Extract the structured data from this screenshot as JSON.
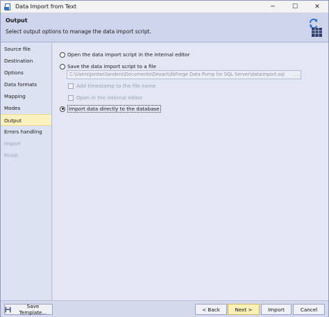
{
  "window": {
    "title": "Data Import from Text",
    "minimize": "─",
    "maximize": "☐",
    "close": "✕"
  },
  "header": {
    "title": "Output",
    "subtitle": "Select output options to manage the data import script.",
    "icon": "import-script-icon"
  },
  "sidebar": {
    "items": [
      {
        "label": "Source file",
        "state": "normal"
      },
      {
        "label": "Destination",
        "state": "normal"
      },
      {
        "label": "Options",
        "state": "normal"
      },
      {
        "label": "Data formats",
        "state": "normal"
      },
      {
        "label": "Mapping",
        "state": "normal"
      },
      {
        "label": "Modes",
        "state": "normal"
      },
      {
        "label": "Output",
        "state": "active"
      },
      {
        "label": "Errors handling",
        "state": "normal"
      },
      {
        "label": "Import",
        "state": "disabled"
      },
      {
        "label": "Finish",
        "state": "disabled"
      }
    ]
  },
  "options": {
    "open_editor": "Open the data import script in the internal editor",
    "save_file": "Save the data import script to a file",
    "file_path": "C:\\Users\\JordanSanders\\Documents\\Devart\\dbForge Data Pump for SQL Server\\dataimport.sql",
    "browse": "…",
    "add_timestamp": "Add timestamp to the file name",
    "open_internal": "Open in the internal editor",
    "import_directly": "Import data directly to the database",
    "selected": "import_directly"
  },
  "footer": {
    "save_template": "Save Template...",
    "back": "< Back",
    "next": "Next >",
    "import": "Import",
    "cancel": "Cancel"
  },
  "colors": {
    "accent_active": "#fbf1bf",
    "primary_button": "#fbf0b8",
    "header_bg": "#ced4eb"
  }
}
